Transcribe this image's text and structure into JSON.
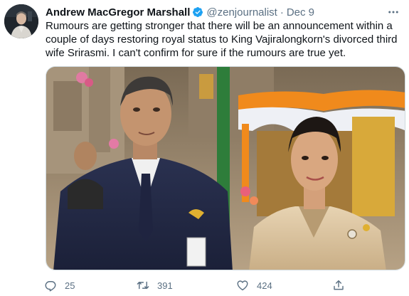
{
  "author": {
    "name": "Andrew MacGregor Marshall",
    "handle": "@zenjournalist",
    "separator": "·",
    "date": "Dec 9"
  },
  "tweet": {
    "text": "Rumours are getting stronger that there will be an announcement within a couple of days restoring royal status to King Vajiralongkorn's divorced third wife Srirasmi. I can't confirm for sure if the rumours are true yet."
  },
  "actions": {
    "reply_count": "25",
    "retweet_count": "391",
    "like_count": "424"
  },
  "icons": {
    "verified": "verified-badge-icon",
    "more": "more-options-icon",
    "reply": "reply-icon",
    "retweet": "retweet-icon",
    "like": "like-icon",
    "share": "share-icon"
  },
  "colors": {
    "text": "#0f1419",
    "secondary": "#5b7083",
    "verified": "#1da1f2"
  }
}
